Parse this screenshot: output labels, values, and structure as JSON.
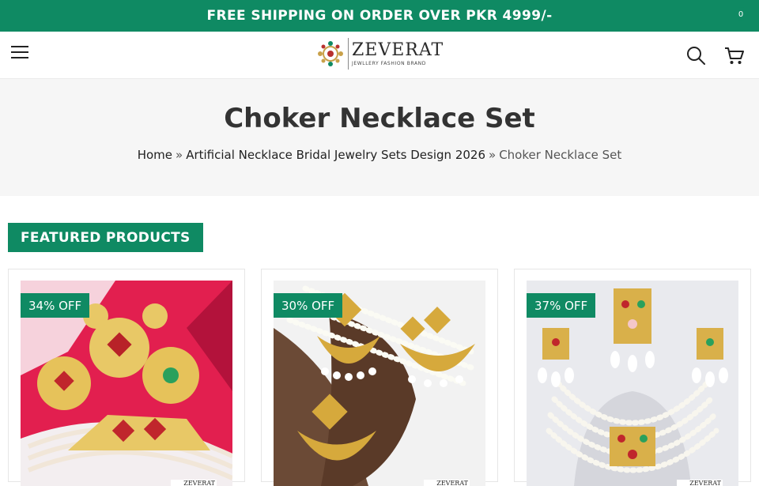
{
  "promo": {
    "text": "FREE SHIPPING ON ORDER OVER PKR 4999/-"
  },
  "header": {
    "logo_name": "ZEVERAT",
    "logo_tagline": "JEWLLERY FASHION BRAND",
    "cart_count": "0",
    "icons": [
      "hamburger-menu-icon",
      "search-icon",
      "cart-icon"
    ]
  },
  "page": {
    "title": "Choker Necklace Set",
    "breadcrumb": {
      "home": "Home",
      "separator": "»",
      "category": "Artificial Necklace Bridal Jewelry Sets Design 2026",
      "current": "Choker Necklace Set"
    }
  },
  "featured": {
    "heading": "FEATURED PRODUCTS",
    "products": [
      {
        "discount": "34% OFF",
        "watermark": "ZEVERAT"
      },
      {
        "discount": "30% OFF",
        "watermark": "ZEVERAT"
      },
      {
        "discount": "37% OFF",
        "watermark": "ZEVERAT"
      }
    ]
  },
  "colors": {
    "brand": "#0f8a63",
    "title_band": "#f6f6f6"
  }
}
